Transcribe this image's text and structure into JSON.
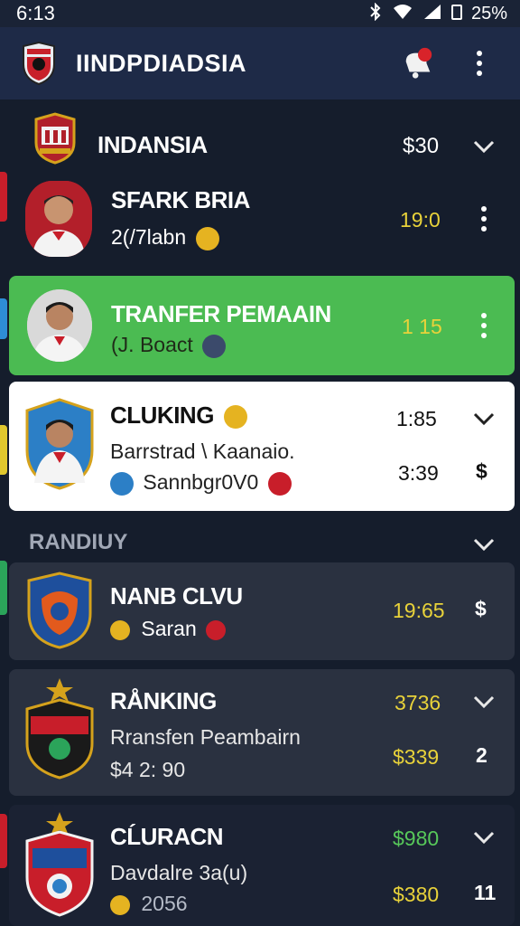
{
  "status_bar": {
    "time": "6:13",
    "battery": "25%"
  },
  "app_bar": {
    "title": "IINDPDIADSIA"
  },
  "header_team": {
    "name": "INDANSIA",
    "value": "$30"
  },
  "rows": [
    {
      "name": "SFARK BRIA",
      "sub": "2(/7labn",
      "value": "19:0"
    },
    {
      "name": "TRANFER PEMAAIN",
      "sub": "(J. Boact",
      "value": "1 15"
    },
    {
      "name": "CLUKING",
      "sub": "Barrstrad \\ Kaanaio.",
      "sub2": "Sannbgr0V0",
      "value": "1:85",
      "value2": "3:39",
      "action2": "$"
    }
  ],
  "section": {
    "title": "RANDIUY"
  },
  "cards": [
    {
      "name": "NANB CLVU",
      "sub": "Saran",
      "value": "19:65",
      "action": "$"
    },
    {
      "name": "RÅNKING",
      "sub": "Rransfen Peambairn",
      "sub2": "$4 2: 90",
      "value": "3736",
      "value2": "$339",
      "action2": "2"
    },
    {
      "name": "CĹURACN",
      "sub": "Davdalre 3a(u)",
      "sub2": "2056",
      "value": "$980",
      "value2": "$380",
      "action2": "11"
    }
  ],
  "colors": {
    "background": "#151d2c",
    "app_bar": "#1e2a47",
    "accent_green": "#4bbb52",
    "value_yellow": "#e8d23a",
    "value_green": "#57c85a"
  }
}
